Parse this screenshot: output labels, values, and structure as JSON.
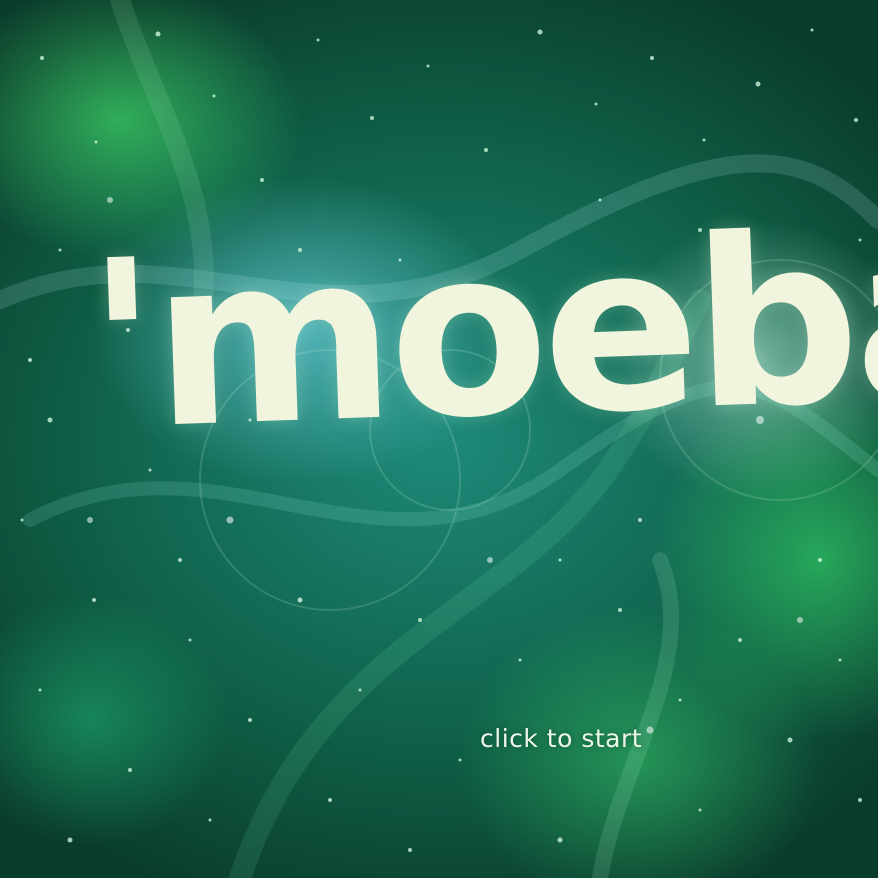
{
  "title": "'moeba",
  "start_prompt": "click to start",
  "colors": {
    "title": "#f2f5de",
    "prompt": "#eef6ea",
    "background_dark": "#0a3c2c",
    "background_mid": "#1e8a7a",
    "glow_green": "#50ff78",
    "glow_cyan": "#82e6ff"
  }
}
